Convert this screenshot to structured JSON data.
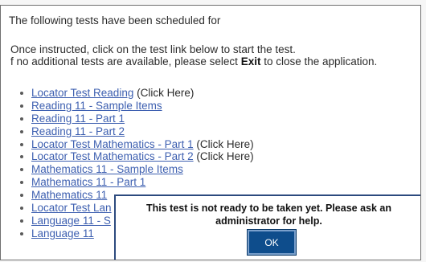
{
  "header": {
    "scheduled_text": "The following tests have been scheduled for",
    "instruction_text": "Once instructed, click on the test link below to start the test.",
    "exit_prefix": "f no additional tests are available, please select ",
    "exit_word": "Exit",
    "exit_suffix": " to close the application."
  },
  "tests": [
    {
      "label": "Locator Test Reading",
      "hint": " (Click Here)"
    },
    {
      "label": "Reading 11 - Sample Items",
      "hint": ""
    },
    {
      "label": "Reading 11 - Part 1",
      "hint": ""
    },
    {
      "label": "Reading 11 - Part 2",
      "hint": ""
    },
    {
      "label": "Locator Test Mathematics - Part 1",
      "hint": " (Click Here)"
    },
    {
      "label": "Locator Test Mathematics - Part 2",
      "hint": " (Click Here)"
    },
    {
      "label": "Mathematics 11 - Sample Items",
      "hint": ""
    },
    {
      "label": "Mathematics 11 - Part 1",
      "hint": ""
    },
    {
      "label": "Mathematics 11",
      "hint": ""
    },
    {
      "label": "Locator Test Lan",
      "hint": ""
    },
    {
      "label": "Language 11 - S",
      "hint": ""
    },
    {
      "label": "Language 11",
      "hint": ""
    }
  ],
  "dialog": {
    "message": "This test is not ready to be taken yet. Please ask an administrator for help.",
    "ok_label": "OK"
  }
}
